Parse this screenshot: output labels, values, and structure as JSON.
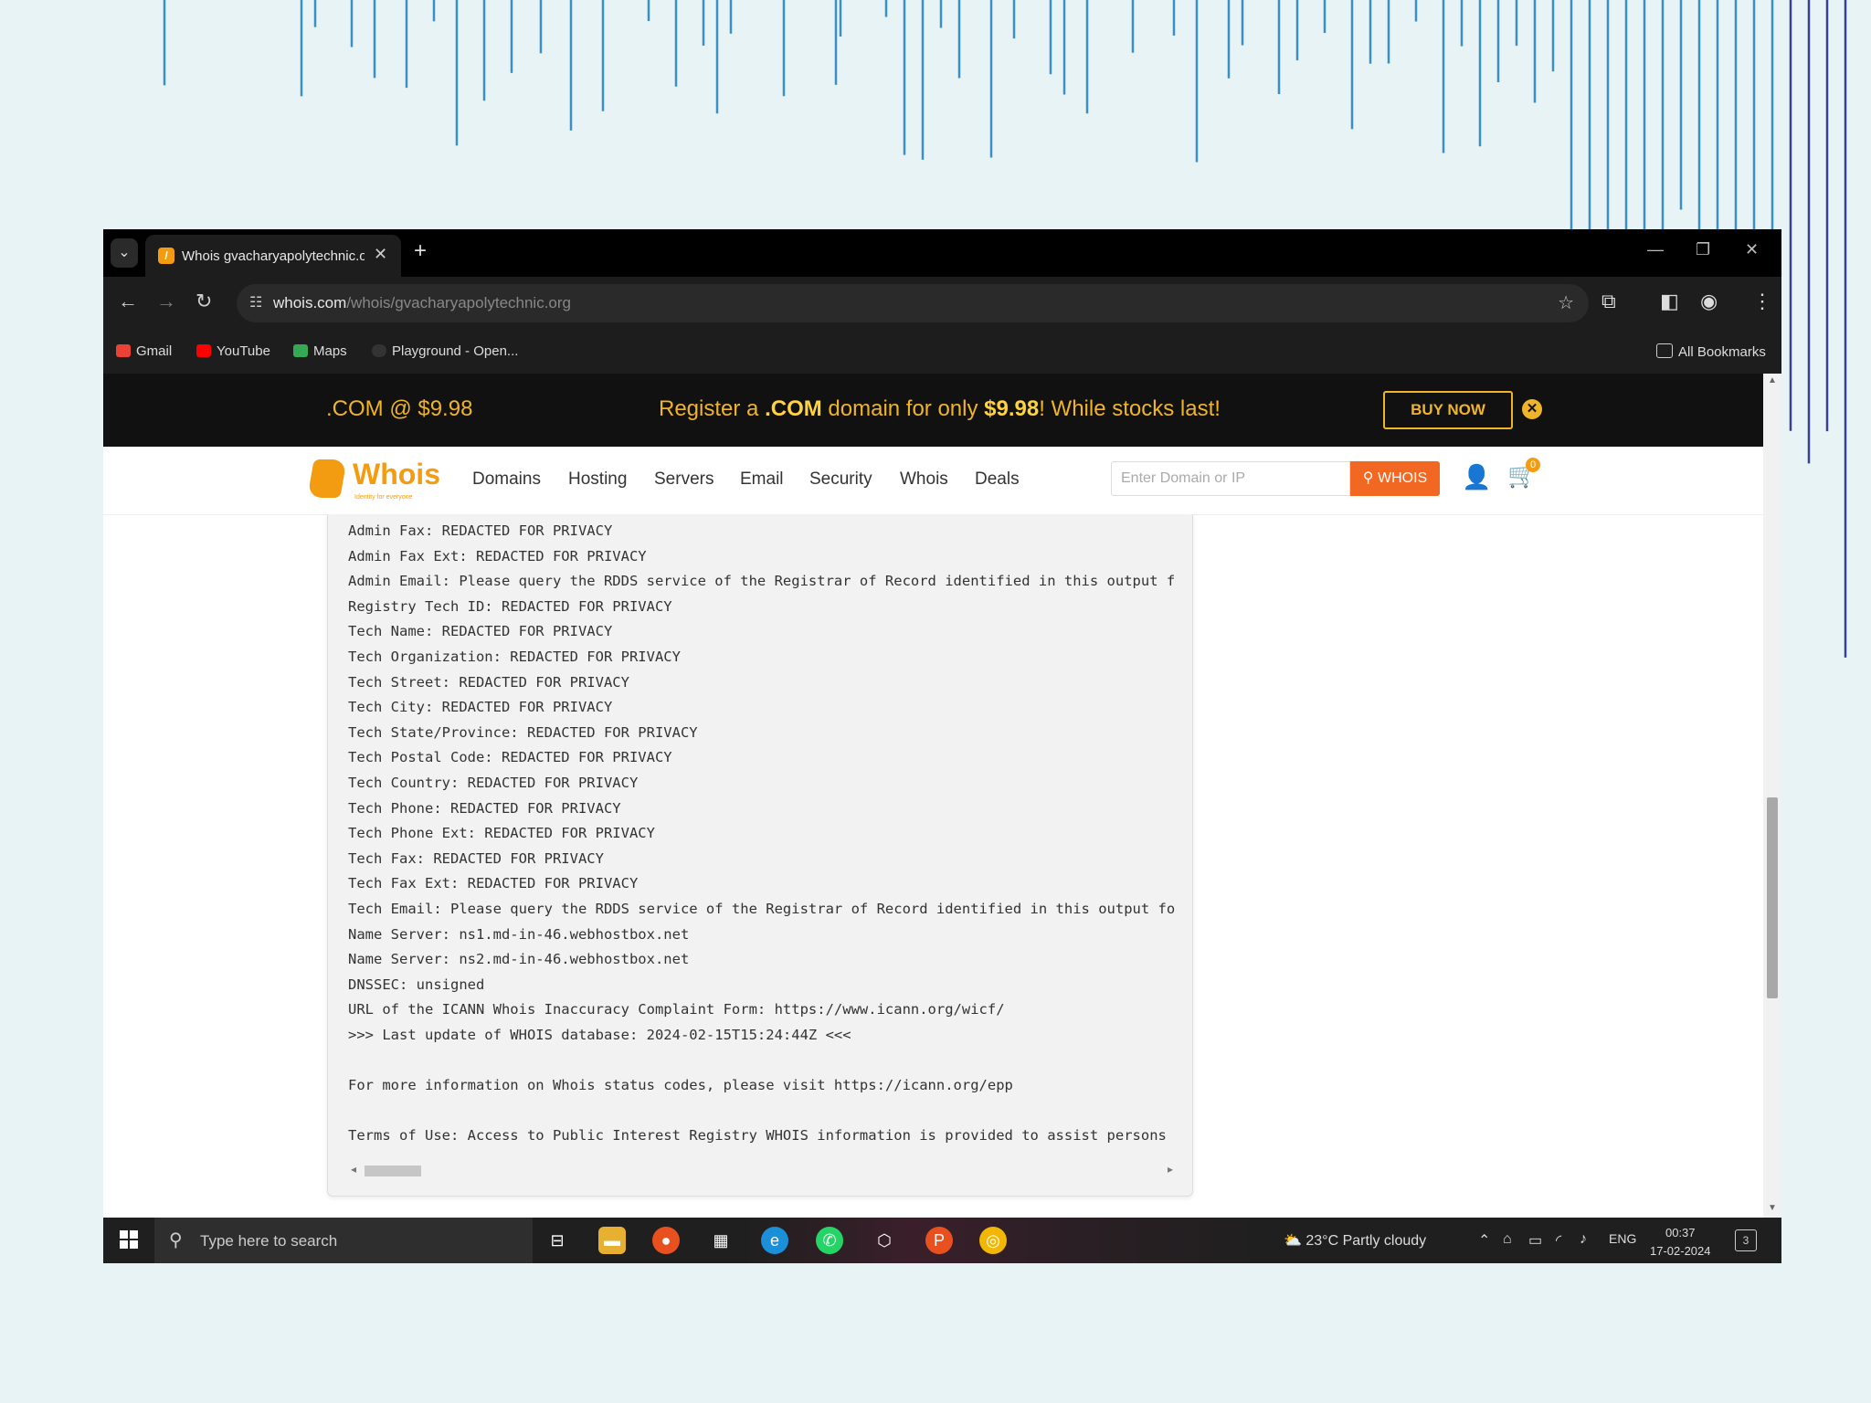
{
  "browser": {
    "tab_title": "Whois gvacharyapolytechnic.org",
    "tab_favicon_icon": "whois-favicon-icon",
    "url_domain": "whois.com",
    "url_path": "/whois/gvacharyapolytechnic.org",
    "bookmarks": [
      "Gmail",
      "YouTube",
      "Maps",
      "Playground - Open..."
    ],
    "all_bookmarks": "All Bookmarks"
  },
  "promo": {
    "left_text": ".COM @ $9.98",
    "pre": "Register a ",
    "tld": ".COM",
    "mid": " domain for only ",
    "price": "$9.98",
    "post": "! While stocks last!",
    "buy_label": "BUY NOW",
    "close_glyph": "✕"
  },
  "site": {
    "logo_text": "Whois",
    "logo_tagline": "Identity for everyone",
    "nav": [
      "Domains",
      "Hosting",
      "Servers",
      "Email",
      "Security",
      "Whois",
      "Deals"
    ],
    "search_placeholder": "Enter Domain or IP",
    "search_button": "WHOIS",
    "cart_count": "0"
  },
  "whois_lines": [
    "Admin Fax: REDACTED FOR PRIVACY",
    "Admin Fax Ext: REDACTED FOR PRIVACY",
    "Admin Email: Please query the RDDS service of the Registrar of Record identified in this output f",
    "Registry Tech ID: REDACTED FOR PRIVACY",
    "Tech Name: REDACTED FOR PRIVACY",
    "Tech Organization: REDACTED FOR PRIVACY",
    "Tech Street: REDACTED FOR PRIVACY",
    "Tech City: REDACTED FOR PRIVACY",
    "Tech State/Province: REDACTED FOR PRIVACY",
    "Tech Postal Code: REDACTED FOR PRIVACY",
    "Tech Country: REDACTED FOR PRIVACY",
    "Tech Phone: REDACTED FOR PRIVACY",
    "Tech Phone Ext: REDACTED FOR PRIVACY",
    "Tech Fax: REDACTED FOR PRIVACY",
    "Tech Fax Ext: REDACTED FOR PRIVACY",
    "Tech Email: Please query the RDDS service of the Registrar of Record identified in this output fo",
    "Name Server: ns1.md-in-46.webhostbox.net",
    "Name Server: ns2.md-in-46.webhostbox.net",
    "DNSSEC: unsigned",
    "URL of the ICANN Whois Inaccuracy Complaint Form: https://www.icann.org/wicf/",
    ">>> Last update of WHOIS database: 2024-02-15T15:24:44Z <<<",
    "",
    "For more information on Whois status codes, please visit https://icann.org/epp",
    "",
    "Terms of Use: Access to Public Interest Registry WHOIS information is provided to assist persons"
  ],
  "taskbar": {
    "search_placeholder": "Type here to search",
    "weather": "23°C  Partly cloudy",
    "lang": "ENG",
    "time": "00:37",
    "date": "17-02-2024",
    "notifications": "3"
  }
}
